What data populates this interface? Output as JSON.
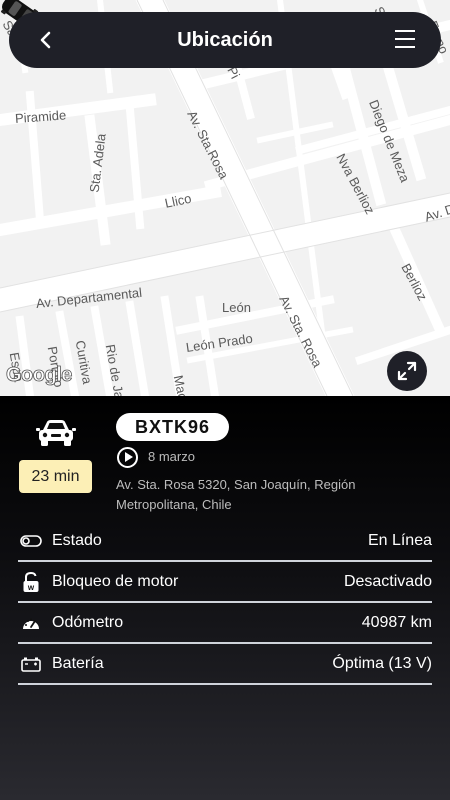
{
  "header": {
    "title": "Ubicación",
    "back_icon": "chevron-left-icon",
    "menu_icon": "hamburger-menu-icon"
  },
  "map": {
    "streets": {
      "piramide": "Piramide",
      "sta_adela": "Sta. Adela",
      "llico": "Llico",
      "av_sta_rosa_top": "Av. Sta.Rosa",
      "av_sta_rosa_bottom": "Av. Sta. Rosa",
      "av_departamental": "Av. Departamental",
      "leon": "León",
      "leon_prado": "León Prado",
      "nva_berlioz": "Nva Berlioz",
      "berlioz": "Berlioz",
      "diego_de_meza": "Diego de Meza",
      "curitiva": "Curitiva",
      "rio_de_jan": "Rio de Jan",
      "portolo": "Portolo",
      "espa": "Espa",
      "mac": "Mac",
      "av_right": "Av. D",
      "top_left": "Sa",
      "top_mid": "Pi",
      "top_s": "S",
      "top_right": "Frano"
    },
    "google_logo": "Google",
    "expand_icon": "expand-icon"
  },
  "vehicle": {
    "plate": "BXTK96",
    "eta": "23 min",
    "date": "8 marzo",
    "address": "Av. Sta. Rosa 5320, San Joaquín, Región Metropolitana, Chile",
    "car_icon": "car-front-icon",
    "play_icon": "play-circle-icon"
  },
  "details": [
    {
      "icon": "toggle-icon",
      "label": "Estado",
      "value": "En Línea"
    },
    {
      "icon": "unlock-icon",
      "label": "Bloqueo de motor",
      "value": "Desactivado"
    },
    {
      "icon": "speedometer-icon",
      "label": "Odómetro",
      "value": "40987 km"
    },
    {
      "icon": "battery-icon",
      "label": "Batería",
      "value": "Óptima (13 V)"
    }
  ],
  "colors": {
    "header_bg": "#1f2028",
    "eta_badge_bg": "#fcefb6",
    "map_bg": "#f2f2f2",
    "divider": "#cfd3da"
  }
}
